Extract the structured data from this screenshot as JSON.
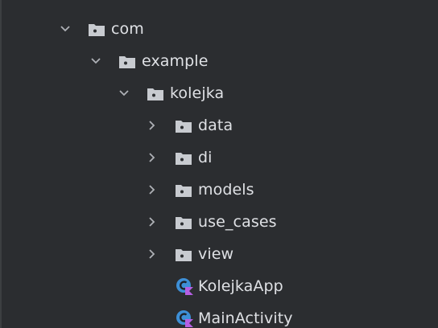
{
  "tree": {
    "nodes": [
      {
        "label": "com",
        "type": "folder",
        "expanded": true
      },
      {
        "label": "example",
        "type": "folder",
        "expanded": true
      },
      {
        "label": "kolejka",
        "type": "folder",
        "expanded": true
      },
      {
        "label": "data",
        "type": "folder",
        "expanded": false
      },
      {
        "label": "di",
        "type": "folder",
        "expanded": false
      },
      {
        "label": "models",
        "type": "folder",
        "expanded": false
      },
      {
        "label": "use_cases",
        "type": "folder",
        "expanded": false
      },
      {
        "label": "view",
        "type": "folder",
        "expanded": false
      },
      {
        "label": "KolejkaApp",
        "type": "kotlin-class"
      },
      {
        "label": "MainActivity",
        "type": "kotlin-class"
      }
    ]
  },
  "icons": {
    "expanded": "chevron-down-icon",
    "collapsed": "chevron-right-icon",
    "folder": "package-folder-icon",
    "kotlin_class": "kotlin-class-icon"
  },
  "colors": {
    "background": "#2b2d30",
    "text": "#dfe1e5",
    "folder": "#c8cbd0",
    "chevron": "#aeb1b6",
    "class_blue": "#3d8fd6",
    "kotlin_purple": "#b55fe3"
  }
}
